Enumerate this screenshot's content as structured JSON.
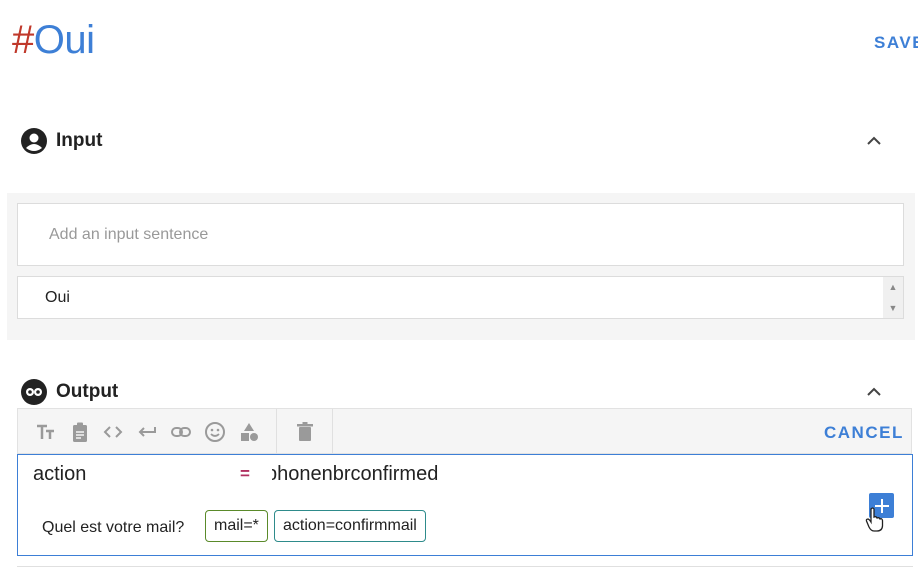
{
  "header": {
    "hash": "#",
    "name": "Oui",
    "save_label": "SAVE"
  },
  "input_section": {
    "title": "Input",
    "add_placeholder": "Add an input sentence",
    "sentence": "Oui"
  },
  "output_section": {
    "title": "Output",
    "toolbar": {
      "icons": [
        "text-format-icon",
        "clipboard-icon",
        "code-icon",
        "return-icon",
        "link-icon",
        "emoji-icon",
        "shapes-icon",
        "trash-icon"
      ],
      "cancel_label": "CANCEL"
    },
    "action": {
      "key": "action",
      "operator": "=",
      "value": "phonenbrconfirmed"
    },
    "quick_reply": {
      "text": "Quel est votre mail?",
      "chips": [
        "mail=*",
        "action=confirmmail"
      ]
    }
  },
  "colors": {
    "accent": "#3d7fd6",
    "hash": "#c0392b",
    "chip_green": "#5a8a2a",
    "chip_teal": "#2e8b8b"
  }
}
